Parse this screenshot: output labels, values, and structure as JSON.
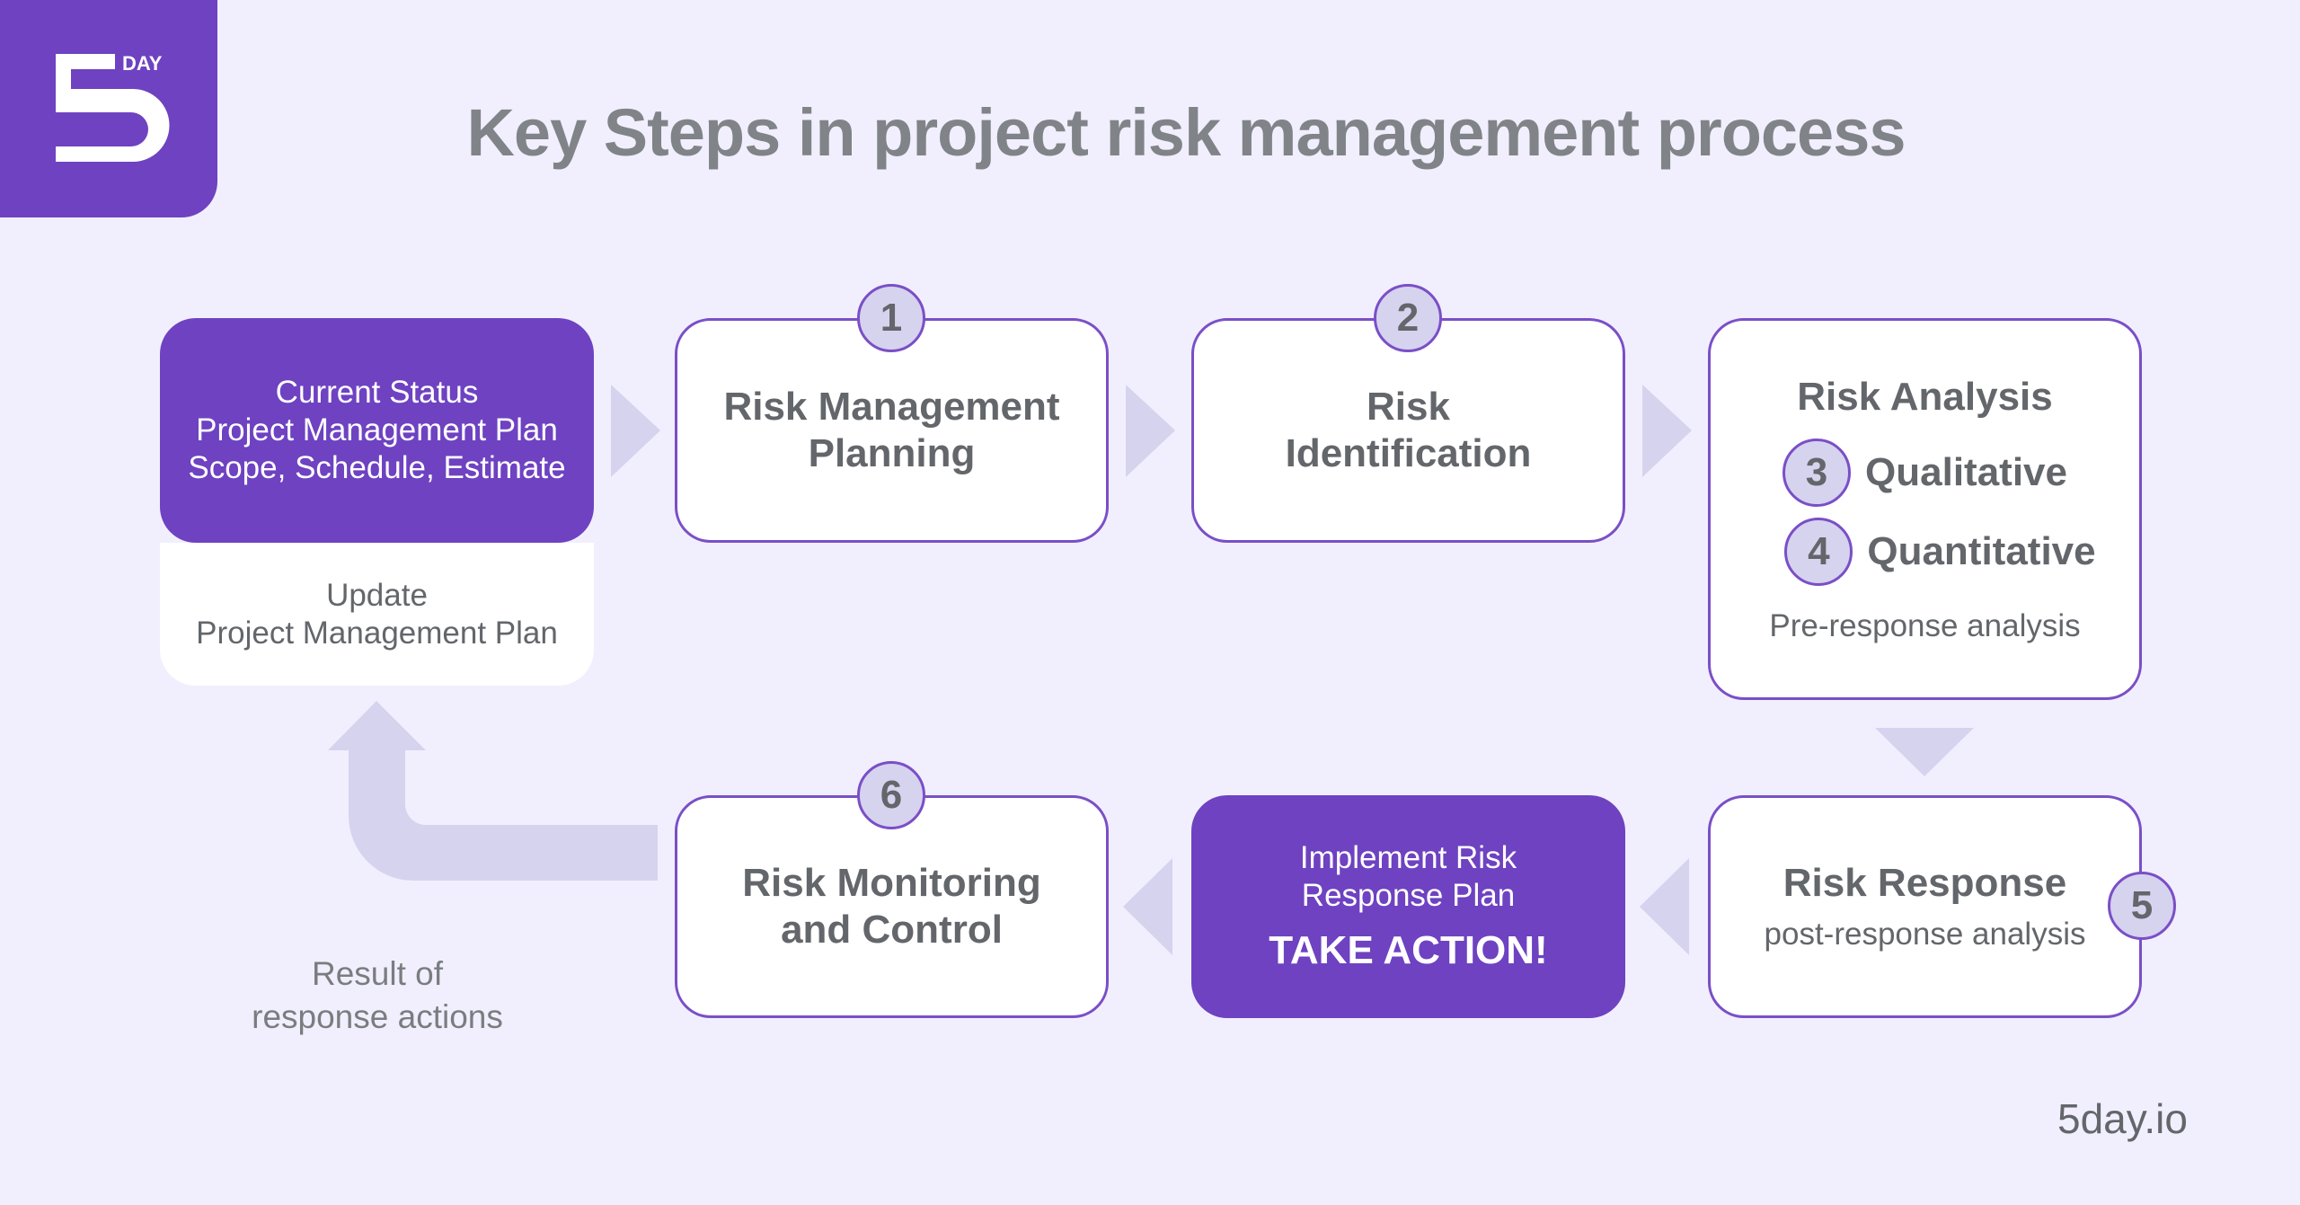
{
  "logo": {
    "text": "DAY",
    "digit": "5"
  },
  "title": "Key Steps in project risk management process",
  "current_status": {
    "lines": [
      "Current Status",
      "Project Management Plan",
      "Scope, Schedule, Estimate"
    ]
  },
  "update_plan": {
    "lines": [
      "Update",
      "Project Management Plan"
    ]
  },
  "steps": {
    "planning": {
      "badge": "1",
      "lines": [
        "Risk Management",
        "Planning"
      ]
    },
    "identification": {
      "badge": "2",
      "lines": [
        "Risk",
        "Identification"
      ]
    },
    "analysis": {
      "title": "Risk Analysis",
      "items": [
        {
          "badge": "3",
          "label": "Qualitative"
        },
        {
          "badge": "4",
          "label": "Quantitative"
        }
      ],
      "note": "Pre-response analysis"
    },
    "response": {
      "badge": "5",
      "title": "Risk Response",
      "note": "post-response analysis"
    },
    "implement": {
      "lines": [
        "Implement Risk",
        "Response Plan"
      ],
      "action": "TAKE ACTION!"
    },
    "monitoring": {
      "badge": "6",
      "lines": [
        "Risk Monitoring",
        "and Control"
      ]
    }
  },
  "loop_label": {
    "lines": [
      "Result of",
      "response actions"
    ]
  },
  "footer": "5day.io",
  "colors": {
    "brand_purple": "#6e42c1",
    "background": "#f1effd",
    "arrow": "#d6d3ef",
    "text_gray": "#63666a"
  }
}
